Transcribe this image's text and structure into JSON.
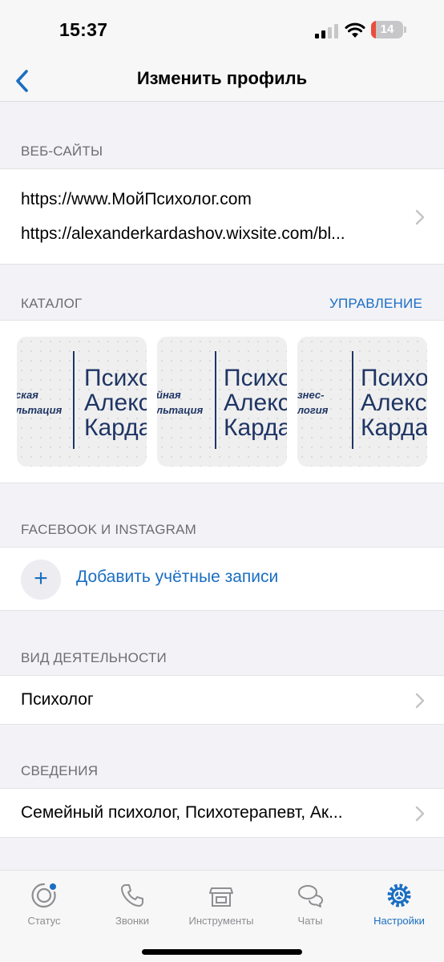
{
  "status_bar": {
    "time": "15:37",
    "battery_level": "14",
    "battery_fraction": 0.14,
    "icons": [
      "cellular-signal-icon",
      "wifi-icon",
      "battery-icon"
    ]
  },
  "nav": {
    "title": "Изменить профиль",
    "back_icon": "chevron-left-icon"
  },
  "websites": {
    "header": "ВЕБ-САЙТЫ",
    "items": [
      "https://www.МойПсихолог.com",
      "https://alexanderkardashov.wixsite.com/bl..."
    ]
  },
  "catalog": {
    "header": "КАТАЛОГ",
    "action": "УПРАВЛЕНИЕ",
    "items": [
      {
        "left_lines": [
          "ская",
          "льтация"
        ],
        "right_lines": [
          "Психо",
          "Алекса",
          "Карда"
        ]
      },
      {
        "left_lines": [
          "йная",
          "льтация"
        ],
        "right_lines": [
          "Психо",
          "Алекса",
          "Кардаш"
        ]
      },
      {
        "left_lines": [
          "знес-",
          "логия"
        ],
        "right_lines": [
          "Психол",
          "Алекса",
          "Кардаш"
        ]
      }
    ]
  },
  "social": {
    "header": "FACEBOOK И INSTAGRAM",
    "add_label": "Добавить учётные записи",
    "add_icon": "plus-icon"
  },
  "activity": {
    "header": "ВИД ДЕЯТЕЛЬНОСТИ",
    "value": "Психолог"
  },
  "info": {
    "header": "СВЕДЕНИЯ",
    "value": "Семейный психолог, Психотерапевт, Ак..."
  },
  "tab_bar": {
    "tabs": [
      {
        "label": "Статус",
        "icon": "status-icon"
      },
      {
        "label": "Звонки",
        "icon": "phone-icon"
      },
      {
        "label": "Инструменты",
        "icon": "storefront-icon"
      },
      {
        "label": "Чаты",
        "icon": "chat-bubbles-icon"
      },
      {
        "label": "Настройки",
        "icon": "gear-icon"
      }
    ],
    "active": "Настройки"
  },
  "colors": {
    "accent": "#1b6ec2",
    "background": "#f2f2f7",
    "secondary_text": "#6d6d72",
    "battery_low": "#eb4d3d",
    "catalog_ink": "#1f3564"
  }
}
